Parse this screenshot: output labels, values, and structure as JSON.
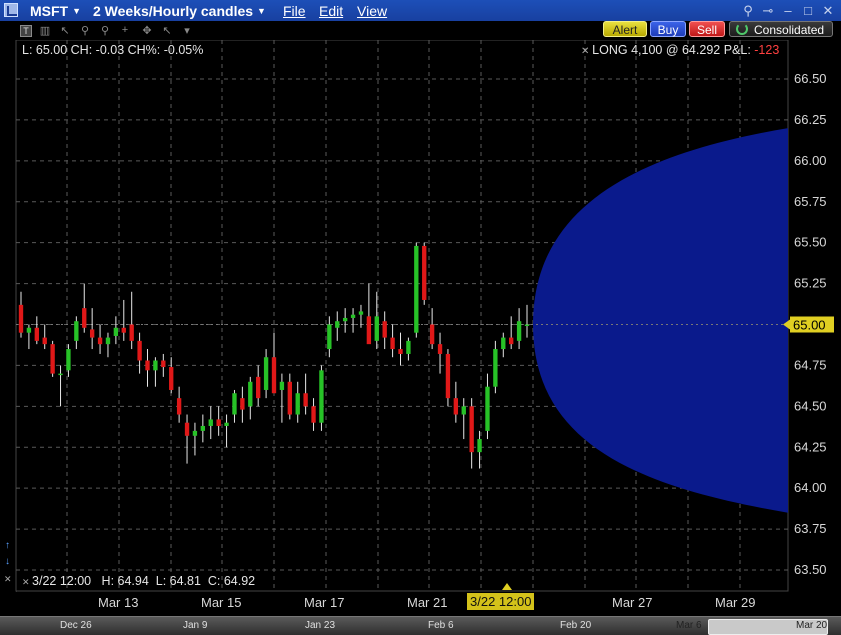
{
  "window": {
    "symbol": "MSFT",
    "period": "2 Weeks/Hourly candles",
    "menus": [
      "File",
      "Edit",
      "View"
    ]
  },
  "actions": {
    "alert": "Alert",
    "buy": "Buy",
    "sell": "Sell",
    "consolidated": "Consolidated"
  },
  "info": {
    "last_line": "L: 65.00 CH: -0.03 CH%: -0.05%",
    "position_prefix": "LONG 4,100 @ 64.292 P&L: ",
    "pnl": "-123",
    "cursor_line": "3/22 12:00   H: 64.94  L: 64.81  C: 64.92"
  },
  "colors": {
    "up": "#27c227",
    "down": "#e01818",
    "forecast": "#0a1a8c",
    "price_highlight": "#e0cf22"
  },
  "chart_data": {
    "type": "candlestick",
    "y_axis": {
      "ticks": [
        "66.50",
        "66.25",
        "66.00",
        "65.75",
        "65.50",
        "65.25",
        "65.00",
        "64.75",
        "64.50",
        "64.25",
        "64.00",
        "63.75",
        "63.50"
      ],
      "range": [
        63.4,
        66.6
      ],
      "current_price_label": "65.00",
      "current_price": 65.0
    },
    "x_axis": {
      "labels": [
        "Mar 13",
        "Mar 15",
        "Mar 17",
        "Mar 21",
        "Mar 27",
        "Mar 29"
      ],
      "highlight_label": "3/22 12:00"
    },
    "overview_axis": {
      "labels": [
        "Dec 26",
        "Jan 9",
        "Jan 23",
        "Feb 6",
        "Feb 20",
        "Mar 6",
        "Mar 20"
      ]
    },
    "forecast_cone": {
      "start_price": 65.0,
      "upper_end": 66.2,
      "lower_end": 63.85
    },
    "candles": [
      [
        65.12,
        65.2,
        64.92,
        64.95
      ],
      [
        64.95,
        65.0,
        64.85,
        64.98
      ],
      [
        64.98,
        65.05,
        64.88,
        64.9
      ],
      [
        64.92,
        65.0,
        64.85,
        64.88
      ],
      [
        64.88,
        64.9,
        64.68,
        64.7
      ],
      [
        64.7,
        64.75,
        64.5,
        64.7
      ],
      [
        64.72,
        64.88,
        64.68,
        64.85
      ],
      [
        64.9,
        65.05,
        64.85,
        65.02
      ],
      [
        65.1,
        65.25,
        64.95,
        64.98
      ],
      [
        64.97,
        65.1,
        64.85,
        64.92
      ],
      [
        64.92,
        65.0,
        64.82,
        64.88
      ],
      [
        64.88,
        64.95,
        64.8,
        64.92
      ],
      [
        64.93,
        65.05,
        64.88,
        64.98
      ],
      [
        64.98,
        65.15,
        64.9,
        64.95
      ],
      [
        65.0,
        65.2,
        64.85,
        64.9
      ],
      [
        64.9,
        64.95,
        64.7,
        64.78
      ],
      [
        64.78,
        64.85,
        64.62,
        64.72
      ],
      [
        64.72,
        64.8,
        64.62,
        64.78
      ],
      [
        64.78,
        64.82,
        64.68,
        64.74
      ],
      [
        64.74,
        64.8,
        64.58,
        64.6
      ],
      [
        64.55,
        64.62,
        64.4,
        64.45
      ],
      [
        64.4,
        64.45,
        64.15,
        64.32
      ],
      [
        64.32,
        64.4,
        64.2,
        64.35
      ],
      [
        64.35,
        64.45,
        64.28,
        64.38
      ],
      [
        64.38,
        64.5,
        64.3,
        64.42
      ],
      [
        64.42,
        64.5,
        64.32,
        64.38
      ],
      [
        64.38,
        64.45,
        64.25,
        64.4
      ],
      [
        64.45,
        64.6,
        64.4,
        64.58
      ],
      [
        64.55,
        64.62,
        64.4,
        64.48
      ],
      [
        64.5,
        64.68,
        64.42,
        64.65
      ],
      [
        64.68,
        64.75,
        64.5,
        64.55
      ],
      [
        64.6,
        64.85,
        64.55,
        64.8
      ],
      [
        64.8,
        64.95,
        64.6,
        64.58
      ],
      [
        64.6,
        64.7,
        64.4,
        64.65
      ],
      [
        64.65,
        64.7,
        64.42,
        64.45
      ],
      [
        64.45,
        64.65,
        64.4,
        64.58
      ],
      [
        64.58,
        64.7,
        64.45,
        64.5
      ],
      [
        64.5,
        64.55,
        64.35,
        64.4
      ],
      [
        64.4,
        64.75,
        64.35,
        64.72
      ],
      [
        64.85,
        65.05,
        64.8,
        65.0
      ],
      [
        64.98,
        65.08,
        64.9,
        65.02
      ],
      [
        65.02,
        65.1,
        64.95,
        65.04
      ],
      [
        65.04,
        65.1,
        64.95,
        65.06
      ],
      [
        65.06,
        65.12,
        64.98,
        65.08
      ],
      [
        65.05,
        65.25,
        64.98,
        64.88
      ],
      [
        64.9,
        65.2,
        64.85,
        65.05
      ],
      [
        65.02,
        65.08,
        64.85,
        64.92
      ],
      [
        64.92,
        65.0,
        64.8,
        64.85
      ],
      [
        64.85,
        64.95,
        64.75,
        64.82
      ],
      [
        64.82,
        64.92,
        64.78,
        64.9
      ],
      [
        64.95,
        65.5,
        64.92,
        65.48
      ],
      [
        65.48,
        65.5,
        65.12,
        65.15
      ],
      [
        65.0,
        65.1,
        64.85,
        64.88
      ],
      [
        64.88,
        64.95,
        64.7,
        64.82
      ],
      [
        64.82,
        64.85,
        64.5,
        64.55
      ],
      [
        64.55,
        64.65,
        64.4,
        64.45
      ],
      [
        64.45,
        64.55,
        64.3,
        64.5
      ],
      [
        64.5,
        64.55,
        64.12,
        64.22
      ],
      [
        64.22,
        64.35,
        64.12,
        64.3
      ],
      [
        64.35,
        64.7,
        64.3,
        64.62
      ],
      [
        64.62,
        64.9,
        64.58,
        64.85
      ],
      [
        64.85,
        64.95,
        64.8,
        64.92
      ],
      [
        64.92,
        65.05,
        64.85,
        64.88
      ],
      [
        64.9,
        65.1,
        64.85,
        65.02
      ],
      [
        65.0,
        65.12,
        64.92,
        65.0
      ]
    ]
  }
}
